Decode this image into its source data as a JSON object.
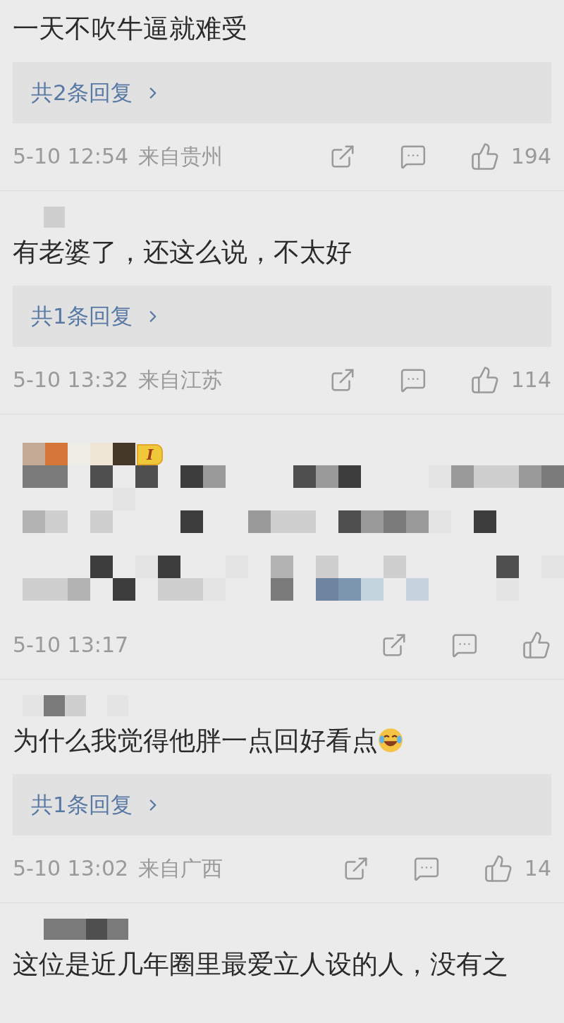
{
  "comments": [
    {
      "text": "一天不吹牛逼就难受",
      "replies": "共2条回复",
      "time": "5-10 12:54",
      "location": "来自贵州",
      "likes": "194"
    },
    {
      "author_hidden": true,
      "text": "有老婆了，还这么说，不太好",
      "replies": "共1条回复",
      "time": "5-10 13:32",
      "location": "来自江苏",
      "likes": "114"
    },
    {
      "author_hidden": true,
      "badge": "I",
      "text_hidden": true,
      "time": "5-10 13:17"
    },
    {
      "author_hidden": true,
      "text": "为什么我觉得他胖一点回好看点",
      "emoji": true,
      "replies": "共1条回复",
      "time": "5-10 13:02",
      "location": "来自广西",
      "likes": "14"
    },
    {
      "author_hidden": true,
      "text": "这位是近几年圈里最爱立人设的人，没有之"
    }
  ]
}
